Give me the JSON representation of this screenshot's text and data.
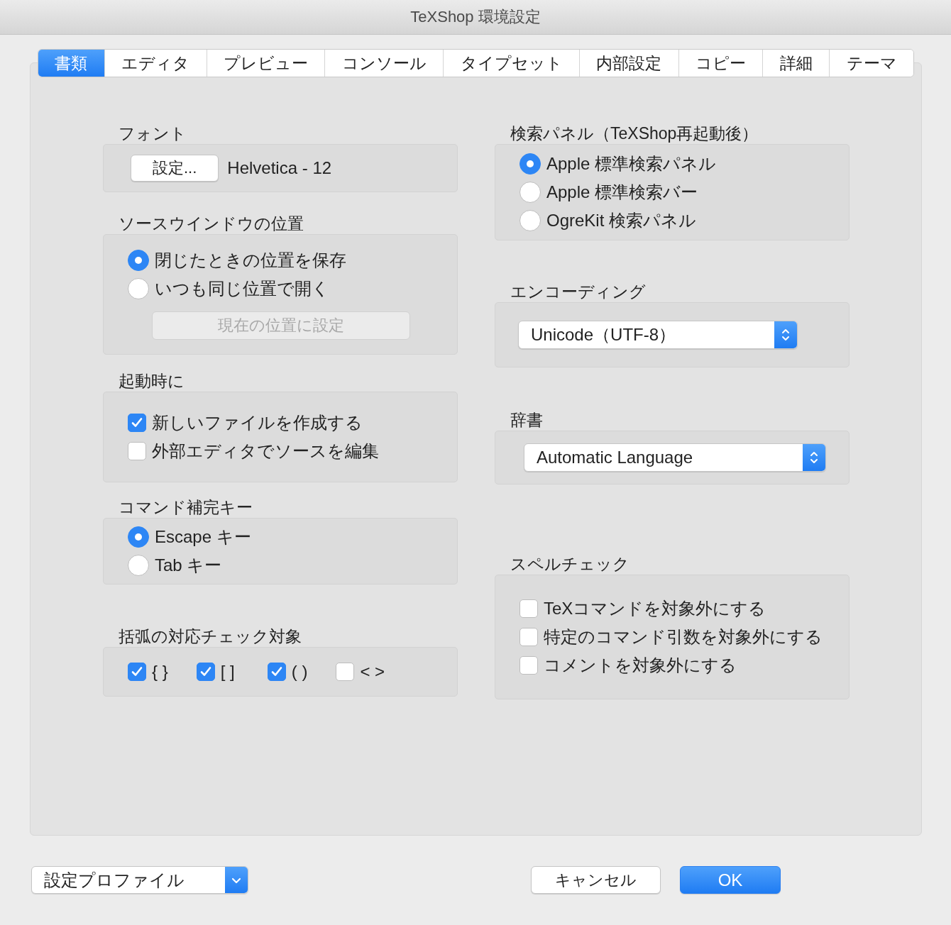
{
  "window": {
    "title": "TeXShop 環境設定"
  },
  "tabs": [
    {
      "label": "書類",
      "selected": true
    },
    {
      "label": "エディタ",
      "selected": false
    },
    {
      "label": "プレビュー",
      "selected": false
    },
    {
      "label": "コンソール",
      "selected": false
    },
    {
      "label": "タイプセット",
      "selected": false
    },
    {
      "label": "内部設定",
      "selected": false
    },
    {
      "label": "コピー",
      "selected": false
    },
    {
      "label": "詳細",
      "selected": false
    },
    {
      "label": "テーマ",
      "selected": false
    }
  ],
  "left": [
    {
      "title": "フォント",
      "kind": "font",
      "button": "設定...",
      "value": "Helvetica - 12"
    },
    {
      "title": "ソースウインドウの位置",
      "kind": "radio",
      "options": [
        {
          "label": "閉じたときの位置を保存",
          "selected": true
        },
        {
          "label": "いつも同じ位置で開く",
          "selected": false
        }
      ],
      "button": {
        "label": "現在の位置に設定",
        "disabled": true
      }
    },
    {
      "title": "起動時に",
      "kind": "checks",
      "items": [
        {
          "label": "新しいファイルを作成する",
          "checked": true
        },
        {
          "label": "外部エディタでソースを編集",
          "checked": false
        }
      ]
    },
    {
      "title": "コマンド補完キー",
      "kind": "radio",
      "options": [
        {
          "label": "Escape キー",
          "selected": true
        },
        {
          "label": "Tab キー",
          "selected": false
        }
      ]
    },
    {
      "title": "括弧の対応チェック対象",
      "kind": "inline",
      "items": [
        {
          "label": "{ }",
          "checked": true
        },
        {
          "label": "[ ]",
          "checked": true
        },
        {
          "label": "( )",
          "checked": true
        },
        {
          "label": "< >",
          "checked": false
        }
      ]
    }
  ],
  "right": [
    {
      "title": "検索パネル（TeXShop再起動後）",
      "kind": "radio",
      "options": [
        {
          "label": "Apple 標準検索パネル",
          "selected": true
        },
        {
          "label": "Apple 標準検索バー",
          "selected": false
        },
        {
          "label": "OgreKit 検索パネル",
          "selected": false
        }
      ]
    },
    {
      "title": "エンコーディング",
      "kind": "popup",
      "value": "Unicode（UTF-8）"
    },
    {
      "title": "辞書",
      "kind": "popup",
      "value": "Automatic Language"
    },
    {
      "title": "スペルチェック",
      "kind": "checks",
      "items": [
        {
          "label": "TeXコマンドを対象外にする",
          "checked": false
        },
        {
          "label": "特定のコマンド引数を対象外にする",
          "checked": false
        },
        {
          "label": "コメントを対象外にする",
          "checked": false
        }
      ]
    }
  ],
  "footer": {
    "profile": "設定プロファイル",
    "cancel": "キャンセル",
    "ok": "OK"
  }
}
